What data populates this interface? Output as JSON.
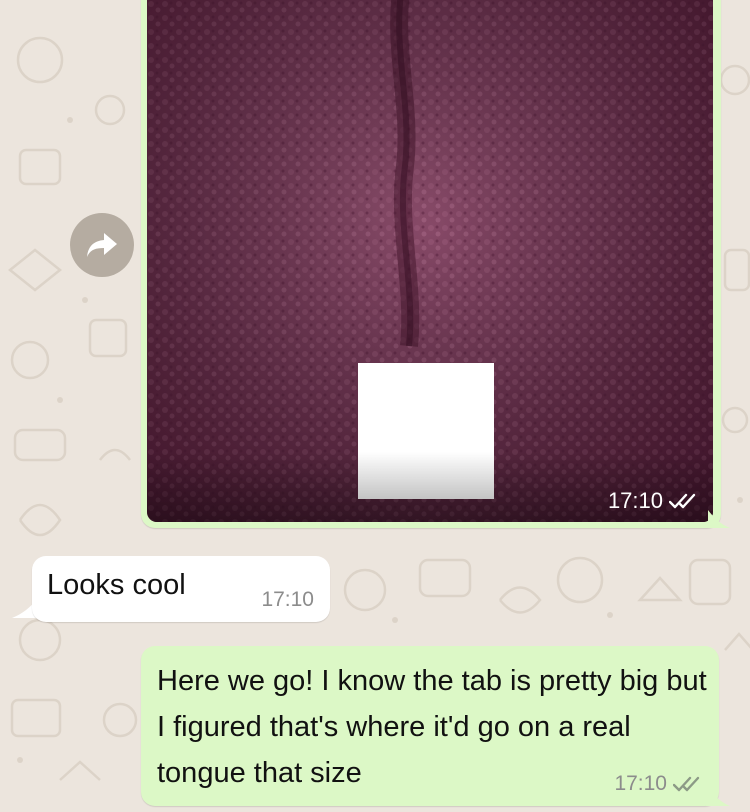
{
  "colors": {
    "background": "#ECE5DD",
    "outgoing_bubble": "#DCF8C6",
    "incoming_bubble": "#FFFFFF",
    "forward_button": "#B5ACA1"
  },
  "forward_button": {
    "icon": "forward-arrow-icon"
  },
  "messages": [
    {
      "type": "image",
      "direction": "outgoing",
      "time": "17:10",
      "status": "read",
      "status_icon": "double-check-icon"
    },
    {
      "type": "text",
      "direction": "incoming",
      "text": "Looks cool",
      "time": "17:10"
    },
    {
      "type": "text",
      "direction": "outgoing",
      "text": "Here we go! I know the tab is pretty big but I figured that's where it'd go on a real tongue that size",
      "time": "17:10",
      "status": "read",
      "status_icon": "double-check-icon"
    }
  ]
}
